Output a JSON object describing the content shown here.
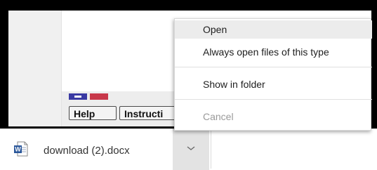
{
  "page": {
    "help_label": "Help",
    "instructions_label": "Instructi"
  },
  "download": {
    "file_name": "download (2).docx",
    "file_icon": "word-document-icon"
  },
  "context_menu": {
    "items": [
      {
        "label": "Open"
      },
      {
        "label": "Always open files of this type"
      },
      {
        "label": "Show in folder"
      },
      {
        "label": "Cancel"
      }
    ]
  },
  "colors": {
    "menu_highlight": "#ececec",
    "chevron_button_bg": "#e3e3e3",
    "word_blue": "#2b579a"
  }
}
